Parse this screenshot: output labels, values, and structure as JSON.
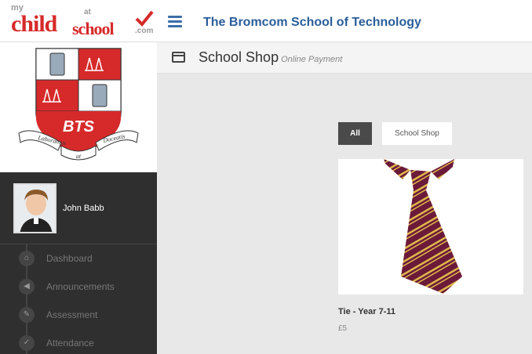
{
  "logo": {
    "my": "my",
    "child": "child",
    "at": "at",
    "school": "school",
    "com": ".com"
  },
  "header": {
    "school_name": "The Bromcom School of Technology"
  },
  "subheader": {
    "title": "School Shop",
    "subtitle": "Online Payment"
  },
  "crest": {
    "initials": "BTS",
    "motto_left": "Laboramus",
    "motto_middle": "ut",
    "motto_right": "Doceatis"
  },
  "user": {
    "name": "John Babb"
  },
  "menu": [
    {
      "label": "Dashboard",
      "icon": "home-icon"
    },
    {
      "label": "Announcements",
      "icon": "megaphone-icon"
    },
    {
      "label": "Assessment",
      "icon": "pencil-icon"
    },
    {
      "label": "Attendance",
      "icon": "check-icon"
    }
  ],
  "filters": {
    "all": "All",
    "school_shop": "School Shop"
  },
  "product": {
    "name": "Tie - Year 7-11",
    "price": "£5"
  },
  "colors": {
    "brand_red": "#d62a2a",
    "header_blue": "#2b5e9a",
    "sidebar_bg": "#2f2f2f",
    "tie_maroon": "#6b1a3a",
    "tie_stripe": "#e0b84a"
  }
}
